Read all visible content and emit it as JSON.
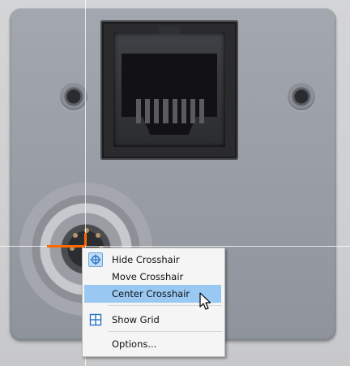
{
  "context_menu": {
    "items": [
      {
        "label": "Hide Crosshair",
        "icon": "crosshair-target-icon",
        "checked": true
      },
      {
        "label": "Move Crosshair",
        "icon": null
      },
      {
        "label": "Center Crosshair",
        "icon": null,
        "highlighted": true
      },
      {
        "label": "Show Grid",
        "icon": "grid-icon"
      },
      {
        "label": "Options...",
        "icon": null
      }
    ]
  },
  "colors": {
    "highlight": "#99c9f3",
    "crosshair_center": "#ff6a00",
    "icon_blue": "#2a6fc2",
    "menu_bg": "#f5f5f5"
  }
}
